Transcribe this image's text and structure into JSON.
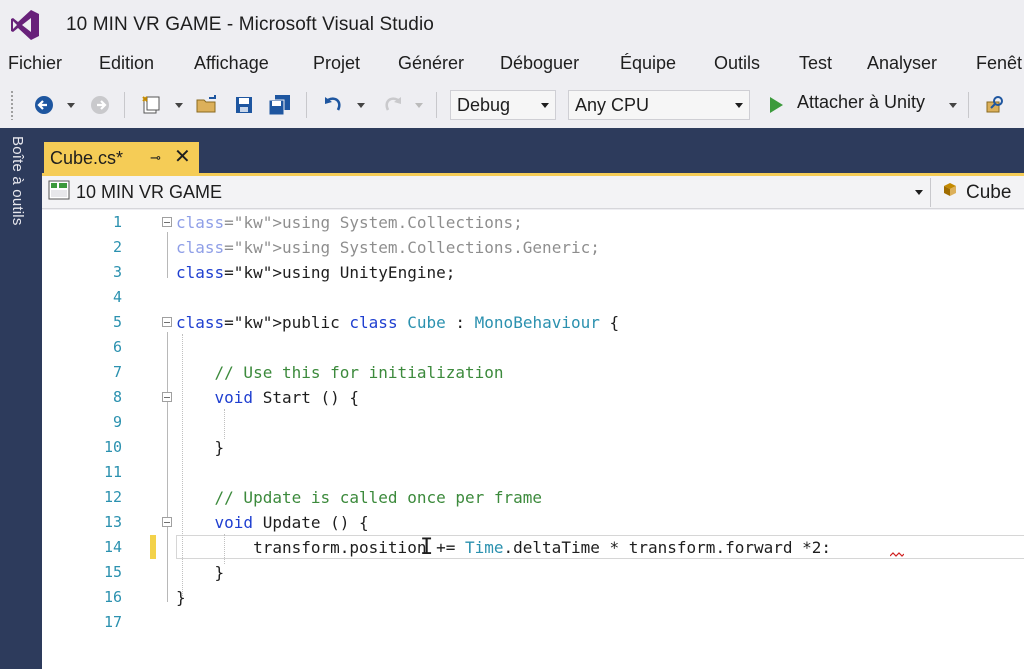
{
  "window": {
    "title": "10 MIN VR GAME - Microsoft Visual Studio"
  },
  "menu": [
    "Fichier",
    "Edition",
    "Affichage",
    "Projet",
    "Générer",
    "Déboguer",
    "Équipe",
    "Outils",
    "Test",
    "Analyser",
    "Fenêt"
  ],
  "toolbar": {
    "configuration": "Debug",
    "platform": "Any CPU",
    "attach_label": "Attacher à Unity"
  },
  "toolbox": {
    "label": "Boîte à outils"
  },
  "tab": {
    "label": "Cube.cs*"
  },
  "navbar": {
    "project": "10 MIN VR GAME",
    "class": "Cube"
  },
  "code": {
    "lines": [
      {
        "n": "1",
        "text": "using System.Collections;"
      },
      {
        "n": "2",
        "text": "using System.Collections.Generic;"
      },
      {
        "n": "3",
        "text": "using UnityEngine;"
      },
      {
        "n": "4",
        "text": ""
      },
      {
        "n": "5",
        "text": "public class Cube : MonoBehaviour {"
      },
      {
        "n": "6",
        "text": ""
      },
      {
        "n": "7",
        "text": "    // Use this for initialization"
      },
      {
        "n": "8",
        "text": "    void Start () {"
      },
      {
        "n": "9",
        "text": ""
      },
      {
        "n": "10",
        "text": "    }"
      },
      {
        "n": "11",
        "text": ""
      },
      {
        "n": "12",
        "text": "    // Update is called once per frame"
      },
      {
        "n": "13",
        "text": "    void Update () {"
      },
      {
        "n": "14",
        "text": "        transform.position += Time.deltaTime * transform.forward *2:"
      },
      {
        "n": "15",
        "text": "    }"
      },
      {
        "n": "16",
        "text": "}"
      },
      {
        "n": "17",
        "text": ""
      }
    ],
    "current_line": 14
  },
  "colors": {
    "keyword": "#1f3fd0",
    "type": "#2b91af",
    "comment": "#3c8a3c",
    "line_number": "#2b91af",
    "tab_active": "#f5cc56",
    "chrome_dark": "#2d3b5c",
    "chrome_light": "#eeeef2"
  }
}
